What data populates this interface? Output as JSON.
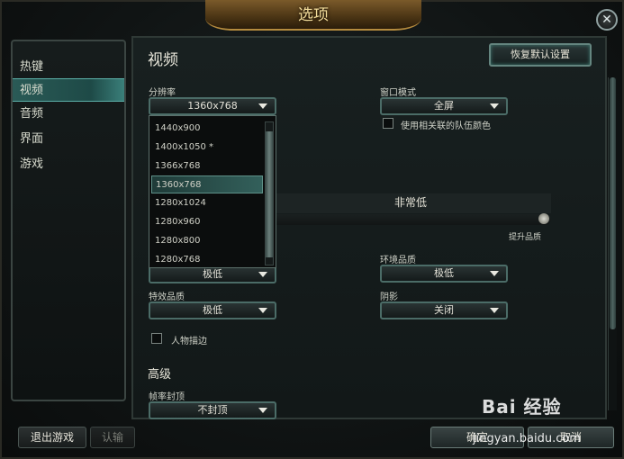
{
  "window": {
    "title": "选项",
    "close_glyph": "✕"
  },
  "sidebar": {
    "items": [
      {
        "label": "热键",
        "active": false
      },
      {
        "label": "视频",
        "active": true
      },
      {
        "label": "音频",
        "active": false
      },
      {
        "label": "界面",
        "active": false
      },
      {
        "label": "游戏",
        "active": false
      }
    ]
  },
  "video": {
    "title": "视频",
    "reset_label": "恢复默认设置",
    "resolution": {
      "label": "分辨率",
      "value": "1360x768",
      "options": [
        "1440x900",
        "1400x1050 *",
        "1366x768",
        "1360x768",
        "1280x1024",
        "1280x960",
        "1280x800",
        "1280x768"
      ],
      "selected_index": 3
    },
    "window_mode": {
      "label": "窗口模式",
      "value": "全屏"
    },
    "team_color": {
      "label": "使用相关联的队伍颜色",
      "checked": false
    },
    "overall_quality": {
      "value_label": "非常低",
      "raise_hint": "提升品质",
      "level": 1.0
    },
    "character_quality": {
      "value": "极低"
    },
    "environment_quality": {
      "label": "环境品质",
      "value": "极低"
    },
    "effects_quality": {
      "label": "特效品质",
      "value": "极低"
    },
    "shadows": {
      "label": "阴影",
      "value": "关闭"
    },
    "outline": {
      "label": "人物描边",
      "checked": false
    },
    "advanced": {
      "title": "高级",
      "frame_cap": {
        "label": "帧率封顶",
        "value": "不封顶"
      }
    }
  },
  "footer": {
    "exit_label": "退出游戏",
    "surrender_label": "认输",
    "confirm_label": "确定",
    "cancel_label": "取消"
  },
  "watermark": {
    "brand": "Bai 经验",
    "url": "jingyan.baidu.com"
  },
  "colors": {
    "accent": "#3a7f7a",
    "title_gold": "#f2dc9a",
    "panel_bg": "#121818"
  }
}
